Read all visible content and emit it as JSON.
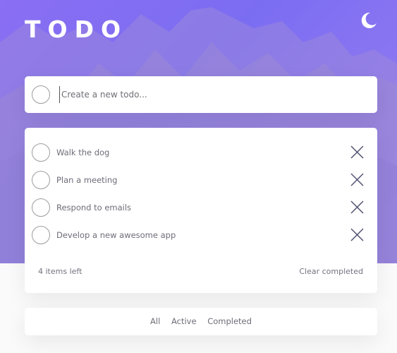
{
  "app": {
    "title": "TODO",
    "theme_toggle_icon": "moon-icon"
  },
  "new_todo": {
    "placeholder": "Create a new todo..."
  },
  "todos": [
    {
      "label": "Walk the dog",
      "completed": false
    },
    {
      "label": "Plan a meeting",
      "completed": false
    },
    {
      "label": "Respond to emails",
      "completed": false
    },
    {
      "label": "Develop a new awesome app",
      "completed": false
    }
  ],
  "footer": {
    "items_left": "4 items left",
    "clear_completed": "Clear completed"
  },
  "filters": {
    "all": "All",
    "active": "Active",
    "completed": "Completed"
  },
  "colors": {
    "hero_gradient_start": "#8a6ef3",
    "hero_gradient_end": "#9a7ff0",
    "card_background": "#ffffff",
    "page_background": "#fafafa",
    "text": "#6d6d78"
  }
}
